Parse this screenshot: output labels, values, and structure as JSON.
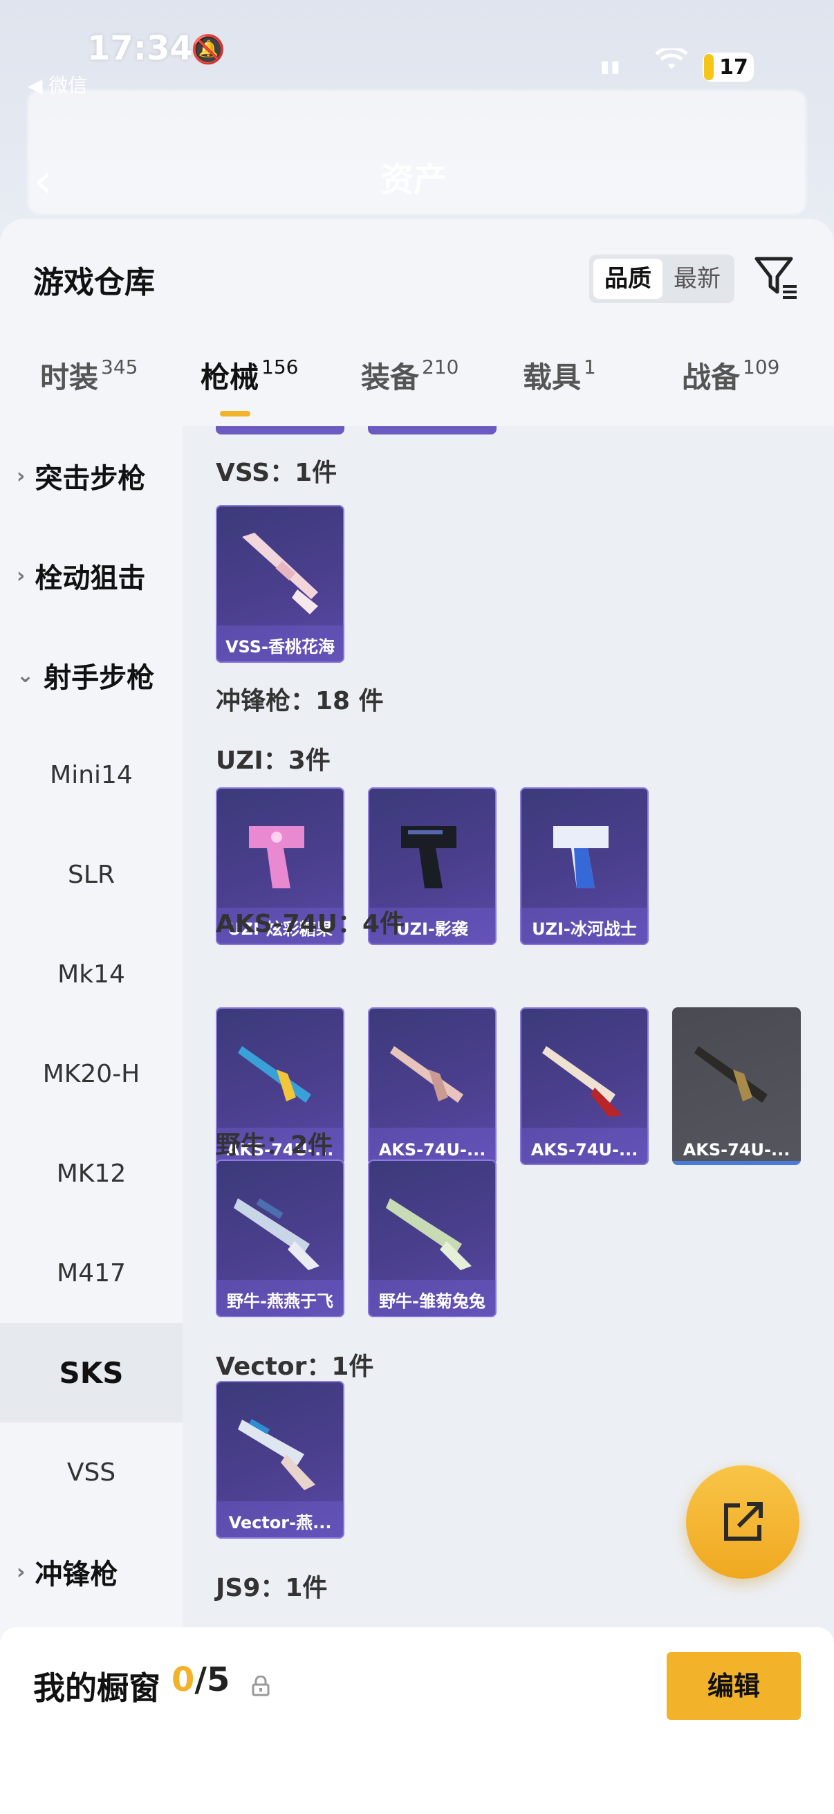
{
  "status_bar": {
    "time": "17:34",
    "back_label": "◀ 微信",
    "battery": "17"
  },
  "background": {
    "title": "资产"
  },
  "warehouse": {
    "title": "游戏仓库",
    "sort": {
      "active": "品质",
      "inactive": "最新"
    },
    "filter_icon": "filter-icon"
  },
  "tabs": [
    {
      "label": "时装",
      "count": "345"
    },
    {
      "label": "枪械",
      "count": "156"
    },
    {
      "label": "装备",
      "count": "210"
    },
    {
      "label": "载具",
      "count": "1"
    },
    {
      "label": "战备",
      "count": "109"
    }
  ],
  "sidebar": {
    "groups": [
      "突击步枪",
      "栓动狙击",
      "射手步枪",
      "冲锋枪"
    ],
    "items": [
      "Mini14",
      "SLR",
      "Mk14",
      "MK20-H",
      "MK12",
      "M417",
      "SKS",
      "VSS"
    ]
  },
  "sections": {
    "vss": "VSS：1件",
    "smg": "冲锋枪：18 件",
    "uzi": "UZI：3件",
    "aks": "AKS-74U：4件",
    "bizon": "野牛：2件",
    "vector": "Vector：1件",
    "js9": "JS9：1件"
  },
  "cards": {
    "vss": [
      "VSS-香桃花海"
    ],
    "uzi": [
      "UZI-炫彩糖果",
      "UZI-影袭",
      "UZI-冰河战士"
    ],
    "aks": [
      "AKS-74U-...",
      "AKS-74U-...",
      "AKS-74U-...",
      "AKS-74U-..."
    ],
    "bizon": [
      "野牛-燕燕于飞",
      "野牛-雏菊兔兔"
    ],
    "vector": [
      "Vector-燕..."
    ]
  },
  "showcase": {
    "title": "我的橱窗",
    "current": "0",
    "total": "/5",
    "edit": "编辑"
  },
  "colors": {
    "accent": "#f2b32a",
    "card_purple": "#4b3f8e",
    "card_gray": "#55565e"
  }
}
